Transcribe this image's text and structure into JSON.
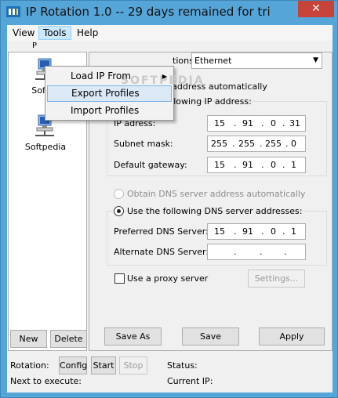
{
  "window": {
    "title": "IP Rotation 1.0  --  29 days remained for tri",
    "close_glyph": "✕"
  },
  "menubar": {
    "view": "View",
    "tools": "Tools",
    "help": "Help"
  },
  "tools_menu": {
    "items": [
      {
        "label": "Load IP From",
        "submenu_glyph": "▶"
      },
      {
        "label": "Export Profiles"
      },
      {
        "label": "Import Profiles"
      }
    ]
  },
  "left": {
    "tab_partial": "P",
    "profiles": [
      {
        "label": "Softpe",
        "icon": "network-computer-icon"
      },
      {
        "label": "Softpedia",
        "icon": "network-computer-icon"
      }
    ],
    "new_button": "New",
    "delete_button": "Delete"
  },
  "right": {
    "connection_label_partial": "tions:",
    "connection_value": "Ethernet",
    "obtain_ip_auto_partial": "P address automatically",
    "use_following_ip": "Use the following IP address:",
    "ip_address_label": "IP adress:",
    "ip_address": [
      "15",
      "91",
      "0",
      "31"
    ],
    "subnet_label": "Subnet mask:",
    "subnet": [
      "255",
      "255",
      "255",
      "0"
    ],
    "gateway_label": "Default gateway:",
    "gateway": [
      "15",
      "91",
      "0",
      "1"
    ],
    "obtain_dns_auto": "Obtain DNS server address automatically",
    "use_following_dns": "Use the following DNS server addresses:",
    "preferred_dns_label": "Preferred DNS Server:",
    "preferred_dns": [
      "15",
      "91",
      "0",
      "1"
    ],
    "alternate_dns_label": "Alternate DNS Server:",
    "alternate_dns": [
      "",
      "",
      "",
      ""
    ],
    "proxy_label": "Use a proxy server",
    "settings_button": "Settings...",
    "save_as_button": "Save As",
    "save_button": "Save",
    "apply_button": "Apply"
  },
  "status": {
    "rotation_label": "Rotation:",
    "config_button": "Config",
    "start_button": "Start",
    "stop_button": "Stop",
    "next_label": "Next to execute:",
    "status_label": "Status:",
    "current_ip_label": "Current IP:"
  },
  "watermark": "SOFTPEDIA",
  "colors": {
    "titlebar": "#56a5d8",
    "close": "#c7433a",
    "menu_highlight": "#cce8ff"
  }
}
